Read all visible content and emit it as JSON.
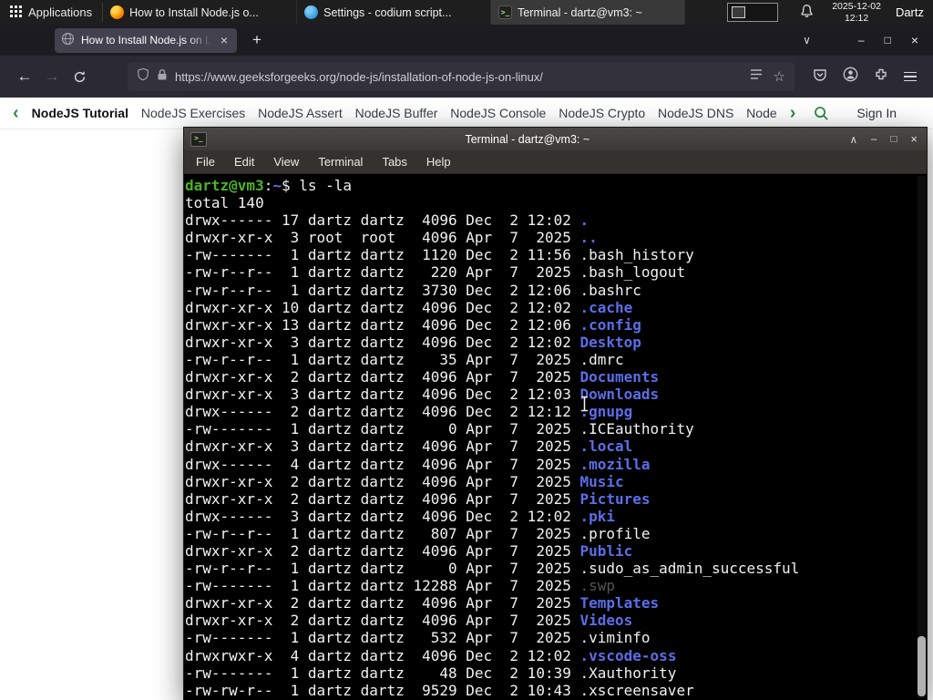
{
  "panel": {
    "applications_label": "Applications",
    "tasks": [
      {
        "title": "How to Install Node.js o...",
        "icon": "firefox"
      },
      {
        "title": "Settings - codium script...",
        "icon": "codium"
      },
      {
        "title": "Terminal - dartz@vm3: ~",
        "icon": "terminal"
      }
    ],
    "clock_date": "2025-12-02",
    "clock_time": "12:12",
    "user_label": "Dartz"
  },
  "browser": {
    "tab": {
      "title": "How to Install Node.js on Linux",
      "close_glyph": "×"
    },
    "new_tab_glyph": "+",
    "all_tabs_glyph": "∨",
    "controls": {
      "minimize": "–",
      "maximize": "□",
      "close": "×"
    },
    "nav": {
      "back_glyph": "←",
      "forward_glyph": "→"
    },
    "url": "https://www.geeksforgeeks.org/node-js/installation-of-node-js-on-linux/",
    "star_glyph": "☆"
  },
  "site_nav": {
    "back_chevron": "‹",
    "forward_chevron": "›",
    "accent_color": "#2f8d46",
    "items": [
      "NodeJS Tutorial",
      "NodeJS Exercises",
      "NodeJS Assert",
      "NodeJS Buffer",
      "NodeJS Console",
      "NodeJS Crypto",
      "NodeJS DNS",
      "Node"
    ],
    "sign_in_label": "Sign In"
  },
  "terminal": {
    "title": "Terminal - dartz@vm3: ~",
    "controls": {
      "shade": "∧",
      "minimize": "–",
      "maximize": "□",
      "close": "×"
    },
    "menu": [
      "File",
      "Edit",
      "View",
      "Terminal",
      "Tabs",
      "Help"
    ],
    "colors": {
      "background": "#000000",
      "foreground": "#f1f1f1",
      "prompt_green": "#4db324",
      "dir_blue": "#5b6ee8",
      "dim": "#565656"
    },
    "lines": [
      [
        {
          "t": "dartz@vm3",
          "c": "green"
        },
        {
          "t": ":",
          "c": "fg"
        },
        {
          "t": "~",
          "c": "blue"
        },
        {
          "t": "$ ls -la",
          "c": "fg"
        }
      ],
      [
        {
          "t": "total 140",
          "c": "fg"
        }
      ],
      [
        {
          "t": "drwx------ 17 dartz dartz  4096 Dec  2 12:02 ",
          "c": "fg"
        },
        {
          "t": ".",
          "c": "blue"
        }
      ],
      [
        {
          "t": "drwxr-xr-x  3 root  root   4096 Apr  7  2025 ",
          "c": "fg"
        },
        {
          "t": "..",
          "c": "blue"
        }
      ],
      [
        {
          "t": "-rw-------  1 dartz dartz  1120 Dec  2 11:56 .bash_history",
          "c": "fg"
        }
      ],
      [
        {
          "t": "-rw-r--r--  1 dartz dartz   220 Apr  7  2025 .bash_logout",
          "c": "fg"
        }
      ],
      [
        {
          "t": "-rw-r--r--  1 dartz dartz  3730 Dec  2 12:06 .bashrc",
          "c": "fg"
        }
      ],
      [
        {
          "t": "drwxr-xr-x 10 dartz dartz  4096 Dec  2 12:02 ",
          "c": "fg"
        },
        {
          "t": ".cache",
          "c": "blue"
        }
      ],
      [
        {
          "t": "drwxr-xr-x 13 dartz dartz  4096 Dec  2 12:06 ",
          "c": "fg"
        },
        {
          "t": ".config",
          "c": "blue"
        }
      ],
      [
        {
          "t": "drwxr-xr-x  3 dartz dartz  4096 Dec  2 12:02 ",
          "c": "fg"
        },
        {
          "t": "Desktop",
          "c": "blue"
        }
      ],
      [
        {
          "t": "-rw-r--r--  1 dartz dartz    35 Apr  7  2025 .dmrc",
          "c": "fg"
        }
      ],
      [
        {
          "t": "drwxr-xr-x  2 dartz dartz  4096 Apr  7  2025 ",
          "c": "fg"
        },
        {
          "t": "Documents",
          "c": "blue"
        }
      ],
      [
        {
          "t": "drwxr-xr-x  3 dartz dartz  4096 Dec  2 12:03 ",
          "c": "fg"
        },
        {
          "t": "Downloads",
          "c": "blue"
        }
      ],
      [
        {
          "t": "drwx------  2 dartz dartz  4096 Dec  2 12:12 ",
          "c": "fg"
        },
        {
          "t": ".gnupg",
          "c": "blue"
        }
      ],
      [
        {
          "t": "-rw-------  1 dartz dartz     0 Apr  7  2025 .ICEauthority",
          "c": "fg"
        }
      ],
      [
        {
          "t": "drwxr-xr-x  3 dartz dartz  4096 Apr  7  2025 ",
          "c": "fg"
        },
        {
          "t": ".local",
          "c": "blue"
        }
      ],
      [
        {
          "t": "drwx------  4 dartz dartz  4096 Apr  7  2025 ",
          "c": "fg"
        },
        {
          "t": ".mozilla",
          "c": "blue"
        }
      ],
      [
        {
          "t": "drwxr-xr-x  2 dartz dartz  4096 Apr  7  2025 ",
          "c": "fg"
        },
        {
          "t": "Music",
          "c": "blue"
        }
      ],
      [
        {
          "t": "drwxr-xr-x  2 dartz dartz  4096 Apr  7  2025 ",
          "c": "fg"
        },
        {
          "t": "Pictures",
          "c": "blue"
        }
      ],
      [
        {
          "t": "drwx------  3 dartz dartz  4096 Dec  2 12:02 ",
          "c": "fg"
        },
        {
          "t": ".pki",
          "c": "blue"
        }
      ],
      [
        {
          "t": "-rw-r--r--  1 dartz dartz   807 Apr  7  2025 .profile",
          "c": "fg"
        }
      ],
      [
        {
          "t": "drwxr-xr-x  2 dartz dartz  4096 Apr  7  2025 ",
          "c": "fg"
        },
        {
          "t": "Public",
          "c": "blue"
        }
      ],
      [
        {
          "t": "-rw-r--r--  1 dartz dartz     0 Apr  7  2025 .sudo_as_admin_successful",
          "c": "fg"
        }
      ],
      [
        {
          "t": "-rw-------  1 dartz dartz 12288 Apr  7  2025 ",
          "c": "fg"
        },
        {
          "t": ".swp",
          "c": "dim"
        }
      ],
      [
        {
          "t": "drwxr-xr-x  2 dartz dartz  4096 Apr  7  2025 ",
          "c": "fg"
        },
        {
          "t": "Templates",
          "c": "blue"
        }
      ],
      [
        {
          "t": "drwxr-xr-x  2 dartz dartz  4096 Apr  7  2025 ",
          "c": "fg"
        },
        {
          "t": "Videos",
          "c": "blue"
        }
      ],
      [
        {
          "t": "-rw-------  1 dartz dartz   532 Apr  7  2025 .viminfo",
          "c": "fg"
        }
      ],
      [
        {
          "t": "drwxrwxr-x  4 dartz dartz  4096 Dec  2 12:02 ",
          "c": "fg"
        },
        {
          "t": ".vscode-oss",
          "c": "blue"
        }
      ],
      [
        {
          "t": "-rw-------  1 dartz dartz    48 Dec  2 10:39 .Xauthority",
          "c": "fg"
        }
      ],
      [
        {
          "t": "-rw-rw-r--  1 dartz dartz  9529 Dec  2 10:43 .xscreensaver",
          "c": "fg"
        }
      ]
    ]
  }
}
